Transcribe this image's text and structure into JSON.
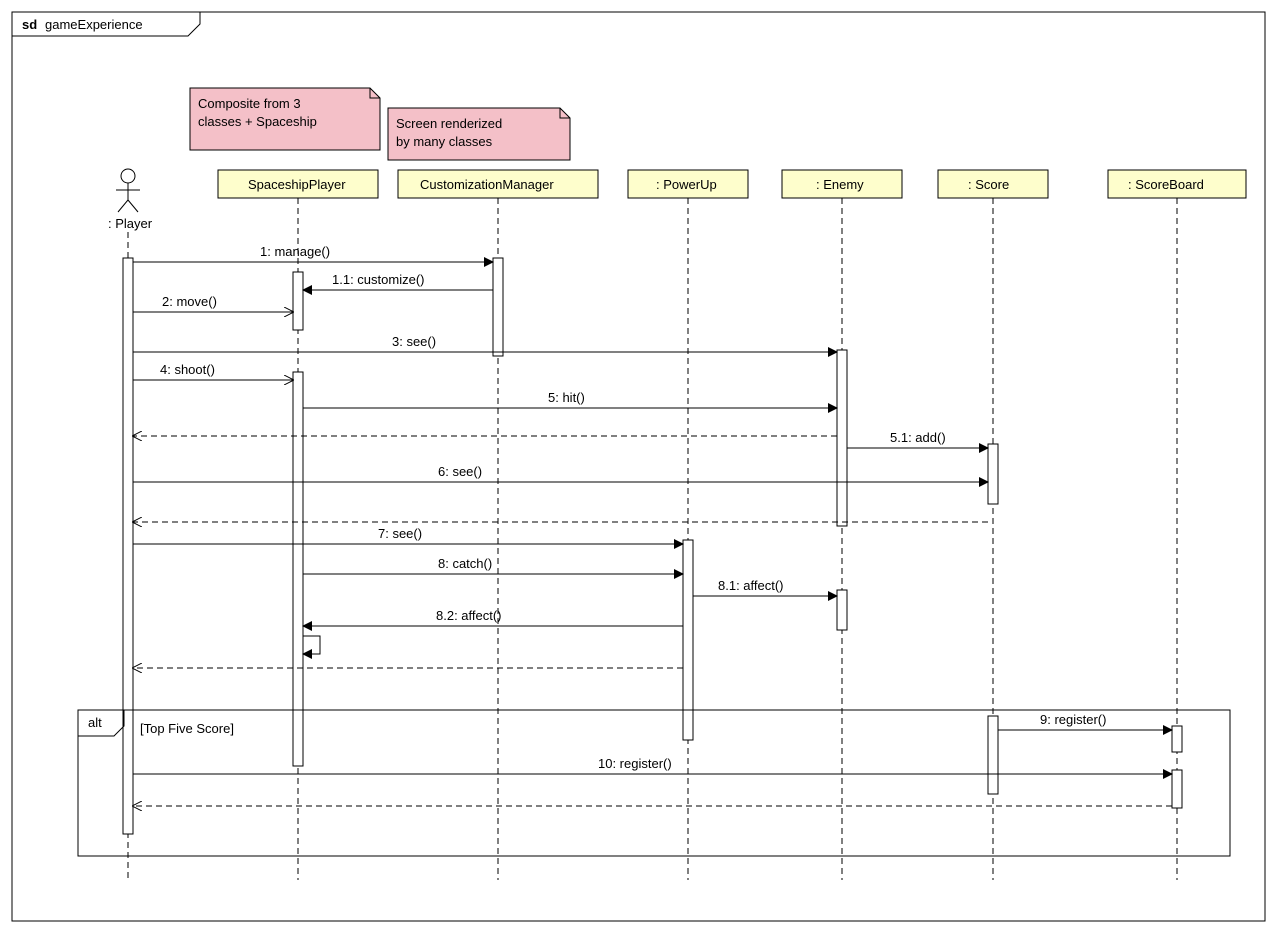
{
  "chart_data": {
    "type": "sequence_diagram",
    "title": "gameExperience",
    "prefix": "sd",
    "actor": ": Player",
    "lifelines": [
      {
        "name": "SpaceshipPlayer",
        "note": "Composite from 3 classes + Spaceship"
      },
      {
        "name": "CustomizationManager",
        "note": "Screen renderized by many classes"
      },
      {
        "name": ": PowerUp"
      },
      {
        "name": ": Enemy"
      },
      {
        "name": ": Score"
      },
      {
        "name": ": ScoreBoard"
      }
    ],
    "messages": [
      {
        "label": "1: manage()",
        "from": "Player",
        "to": "CustomizationManager",
        "style": "solid"
      },
      {
        "label": "1.1: customize()",
        "from": "CustomizationManager",
        "to": "SpaceshipPlayer",
        "style": "solid"
      },
      {
        "label": "2: move()",
        "from": "Player",
        "to": "SpaceshipPlayer",
        "style": "solid"
      },
      {
        "label": "3: see()",
        "from": "Player",
        "to": "Enemy",
        "style": "solid"
      },
      {
        "label": "4: shoot()",
        "from": "Player",
        "to": "SpaceshipPlayer",
        "style": "solid"
      },
      {
        "label": "5: hit()",
        "from": "SpaceshipPlayer",
        "to": "Enemy",
        "style": "solid"
      },
      {
        "label": "5.1: add()",
        "from": "Enemy",
        "to": "Score",
        "style": "solid"
      },
      {
        "label": "6: see()",
        "from": "Player",
        "to": "Score",
        "style": "solid"
      },
      {
        "label": "7: see()",
        "from": "Player",
        "to": "PowerUp",
        "style": "solid"
      },
      {
        "label": "8: catch()",
        "from": "SpaceshipPlayer",
        "to": "PowerUp",
        "style": "solid"
      },
      {
        "label": "8.1: affect()",
        "from": "PowerUp",
        "to": "Enemy",
        "style": "solid"
      },
      {
        "label": "8.2: affect()",
        "from": "PowerUp",
        "to": "SpaceshipPlayer",
        "style": "solid"
      },
      {
        "label": "9: register()",
        "from": "Score",
        "to": "ScoreBoard",
        "style": "solid"
      },
      {
        "label": "10: register()",
        "from": "Player",
        "to": "ScoreBoard",
        "style": "solid"
      }
    ],
    "fragment": {
      "type": "alt",
      "guard": "[Top Five Score]"
    }
  },
  "notes": {
    "n1l1": "Composite from 3",
    "n1l2": "classes + Spaceship",
    "n2l1": "Screen renderized",
    "n2l2": "by many classes"
  },
  "frame": {
    "prefix": "sd",
    "title": "gameExperience"
  },
  "actor": ": Player",
  "lifelines": {
    "l1": "SpaceshipPlayer",
    "l2": "CustomizationManager",
    "l3": ": PowerUp",
    "l4": ": Enemy",
    "l5": ": Score",
    "l6": ": ScoreBoard"
  },
  "msgs": {
    "m1": "1: manage()",
    "m1_1": "1.1: customize()",
    "m2": "2: move()",
    "m3": "3: see()",
    "m4": "4: shoot()",
    "m5": "5: hit()",
    "m5_1": "5.1: add()",
    "m6": "6: see()",
    "m7": "7: see()",
    "m8": "8: catch()",
    "m8_1": "8.1: affect()",
    "m8_2": "8.2: affect()",
    "m9": "9: register()",
    "m10": "10: register()"
  },
  "alt": {
    "label": "alt",
    "guard": "[Top Five Score]"
  }
}
